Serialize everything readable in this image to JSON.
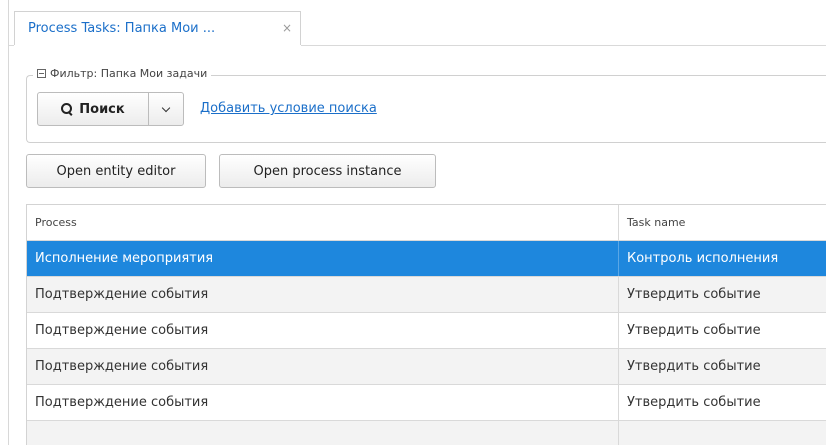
{
  "tabs": [
    {
      "label": "Process Tasks: Папка Мои ...",
      "close_glyph": "×"
    }
  ],
  "filter": {
    "legend": "Фильтр: Папка Мои задачи",
    "search_button_label": "Поиск",
    "add_condition_link": "Добавить условие поиска"
  },
  "toolbar": {
    "open_entity_editor": "Open entity editor",
    "open_process_instance": "Open process instance"
  },
  "table": {
    "columns": [
      "Process",
      "Task name"
    ],
    "rows": [
      {
        "process": "Исполнение мероприятия",
        "task": "Контроль исполнения",
        "selected": true
      },
      {
        "process": "Подтверждение события",
        "task": "Утвердить событие",
        "selected": false
      },
      {
        "process": "Подтверждение события",
        "task": "Утвердить событие",
        "selected": false
      },
      {
        "process": "Подтверждение события",
        "task": "Утвердить событие",
        "selected": false
      },
      {
        "process": "Подтверждение события",
        "task": "Утвердить событие",
        "selected": false
      }
    ]
  },
  "colors": {
    "accent": "#1b6fc9",
    "selected_row": "#1e87dd"
  }
}
